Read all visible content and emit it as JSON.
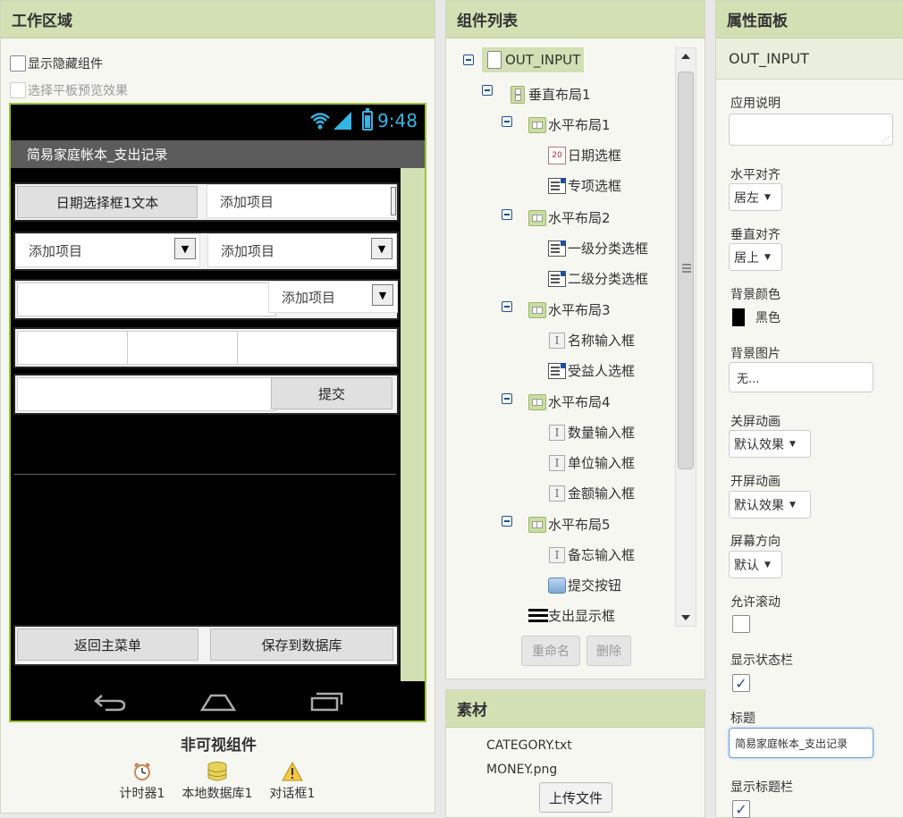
{
  "workspace": {
    "title": "工作区域",
    "show_hidden_label": "显示隐藏组件",
    "tablet_preview_label": "选择平板预览效果",
    "phone": {
      "time": "9:48",
      "app_title": "简易家庭帐本_支出记录",
      "date_picker_label": "日期选择框1文本",
      "spinner_1": "添加项目",
      "spinner_2": "添加项目",
      "spinner_3": "添加项目",
      "spinner_4": "添加项目",
      "submit_label": "提交",
      "back_label": "返回主菜单",
      "save_label": "保存到数据库"
    },
    "nonvisible": {
      "title": "非可视组件",
      "items": [
        "计时器1",
        "本地数据库1",
        "对话框1"
      ]
    }
  },
  "components": {
    "title": "组件列表",
    "tree": [
      {
        "label": "OUT_INPUT",
        "icon": "screen-icon",
        "depth": 0,
        "collapsible": true,
        "selected": true
      },
      {
        "label": "垂直布局1",
        "icon": "vertical-arrangement-icon",
        "depth": 1,
        "collapsible": true
      },
      {
        "label": "水平布局1",
        "icon": "horizontal-arrangement-icon",
        "depth": 2,
        "collapsible": true
      },
      {
        "label": "日期选框",
        "icon": "datepicker-icon",
        "depth": 3
      },
      {
        "label": "专项选框",
        "icon": "spinner-icon",
        "depth": 3
      },
      {
        "label": "水平布局2",
        "icon": "horizontal-arrangement-icon",
        "depth": 2,
        "collapsible": true
      },
      {
        "label": "一级分类选框",
        "icon": "spinner-icon",
        "depth": 3
      },
      {
        "label": "二级分类选框",
        "icon": "spinner-icon",
        "depth": 3
      },
      {
        "label": "水平布局3",
        "icon": "horizontal-arrangement-icon",
        "depth": 2,
        "collapsible": true
      },
      {
        "label": "名称输入框",
        "icon": "textbox-icon",
        "depth": 3
      },
      {
        "label": "受益人选框",
        "icon": "spinner-icon",
        "depth": 3
      },
      {
        "label": "水平布局4",
        "icon": "horizontal-arrangement-icon",
        "depth": 2,
        "collapsible": true
      },
      {
        "label": "数量输入框",
        "icon": "textbox-icon",
        "depth": 3
      },
      {
        "label": "单位输入框",
        "icon": "textbox-icon",
        "depth": 3
      },
      {
        "label": "金额输入框",
        "icon": "textbox-icon",
        "depth": 3
      },
      {
        "label": "水平布局5",
        "icon": "horizontal-arrangement-icon",
        "depth": 2,
        "collapsible": true
      },
      {
        "label": "备忘输入框",
        "icon": "textbox-icon",
        "depth": 3
      },
      {
        "label": "提交按钮",
        "icon": "button-icon",
        "depth": 3
      },
      {
        "label": "支出显示框",
        "icon": "listview-icon",
        "depth": 2
      }
    ],
    "rename_label": "重命名",
    "delete_label": "删除"
  },
  "media": {
    "title": "素材",
    "files": [
      "CATEGORY.txt",
      "MONEY.png"
    ],
    "upload_label": "上传文件"
  },
  "properties": {
    "title": "属性面板",
    "component_name": "OUT_INPUT",
    "app_desc_label": "应用说明",
    "app_desc_value": "",
    "align_h_label": "水平对齐",
    "align_h_value": "居左",
    "align_v_label": "垂直对齐",
    "align_v_value": "居上",
    "bg_color_label": "背景颜色",
    "bg_color_value": "黑色",
    "bg_color_hex": "#000000",
    "bg_image_label": "背景图片",
    "bg_image_value": "无...",
    "close_anim_label": "关屏动画",
    "close_anim_value": "默认效果",
    "open_anim_label": "开屏动画",
    "open_anim_value": "默认效果",
    "orientation_label": "屏幕方向",
    "orientation_value": "默认",
    "scrollable_label": "允许滚动",
    "scrollable_checked": false,
    "show_status_label": "显示状态栏",
    "show_status_checked": true,
    "title_label": "标题",
    "title_value": "简易家庭帐本_支出记录",
    "show_title_label": "显示标题栏",
    "show_title_checked": true
  },
  "colors": {
    "accent_green": "#d2e0b4",
    "phone_border": "#9bc33a",
    "status_blue": "#33b5e5",
    "tree_blue": "#1d4f9c"
  }
}
